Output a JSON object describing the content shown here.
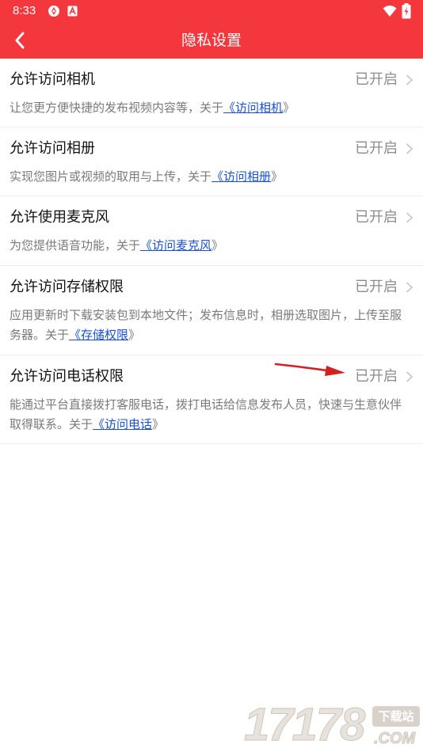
{
  "status_bar": {
    "time": "8:33",
    "icons": [
      "app-notification-icon",
      "a-badge-icon",
      "wifi-icon",
      "battery-charging-icon"
    ]
  },
  "header": {
    "title": "隐私设置",
    "back_icon": "chevron-left-icon"
  },
  "colors": {
    "header_bg": "#f4373c",
    "link": "#1a4fd6",
    "status_text": "#8c8c8c",
    "desc_text": "#7a7a7a",
    "annotation_arrow": "#d42020"
  },
  "permissions": [
    {
      "title": "允许访问相机",
      "status": "已开启",
      "desc_prefix": "让您更方便快捷的发布视频内容等，关于",
      "link": "《访问相机",
      "desc_suffix": "》"
    },
    {
      "title": "允许访问相册",
      "status": "已开启",
      "desc_prefix": "实现您图片或视频的取用与上传，关于",
      "link": "《访问相册",
      "desc_suffix": "》"
    },
    {
      "title": "允许使用麦克风",
      "status": "已开启",
      "desc_prefix": "为您提供语音功能，关于",
      "link": "《访问麦克风",
      "desc_suffix": "》"
    },
    {
      "title": "允许访问存储权限",
      "status": "已开启",
      "desc_prefix": "应用更新时下载安装包到本地文件；发布信息时，相册选取图片，上传至服务器。关于",
      "link": "《存储权限",
      "desc_suffix": "》"
    },
    {
      "title": "允许访问电话权限",
      "status": "已开启",
      "desc_prefix": "能通过平台直接拨打客服电话，拨打电话给信息发布人员，快速与生意伙伴取得联系。关于",
      "link": "《访问电话",
      "desc_suffix": "》"
    }
  ],
  "watermark": {
    "digits": "17178",
    "badge": "下载站",
    "suffix": ".COM"
  }
}
